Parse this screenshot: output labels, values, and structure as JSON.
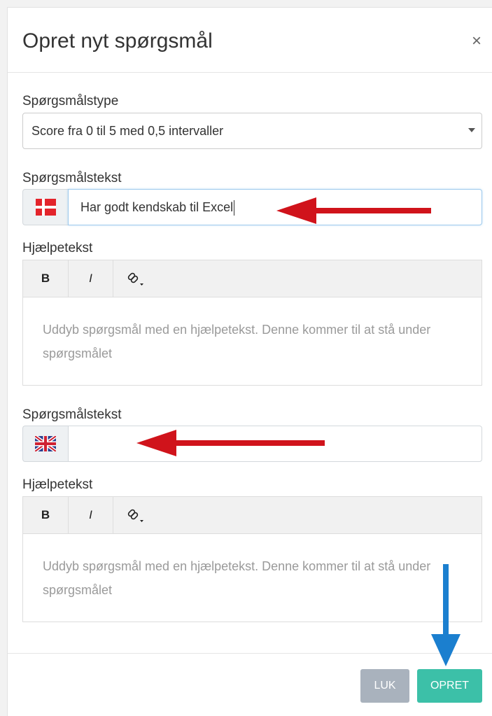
{
  "dialog": {
    "title": "Opret nyt spørgsmål",
    "close_symbol": "×"
  },
  "question_type": {
    "label": "Spørgsmålstype",
    "selected": "Score fra 0 til 5 med 0,5 intervaller"
  },
  "danish": {
    "text_label": "Spørgsmålstekst",
    "flag_icon": "denmark-flag-icon",
    "text_value": "Har godt kendskab til Excel",
    "help_label": "Hjælpetekst",
    "toolbar": {
      "bold": "B",
      "italic": "I",
      "link_icon": "link-icon"
    },
    "help_placeholder": "Uddyb spørgsmål med en hjælpetekst. Denne kommer til at stå under spørgsmålet"
  },
  "english": {
    "text_label": "Spørgsmålstekst",
    "flag_icon": "uk-flag-icon",
    "text_value": "",
    "help_label": "Hjælpetekst",
    "toolbar": {
      "bold": "B",
      "italic": "I",
      "link_icon": "link-icon"
    },
    "help_placeholder": "Uddyb spørgsmål med en hjælpetekst. Denne kommer til at stå under spørgsmålet"
  },
  "footer": {
    "close_label": "LUK",
    "create_label": "OPRET"
  },
  "colors": {
    "create_button": "#3cc0a8",
    "close_button": "#a9b2bd",
    "annotation_red_arrow": "#d0131b",
    "annotation_blue_arrow": "#1b7fcf"
  }
}
